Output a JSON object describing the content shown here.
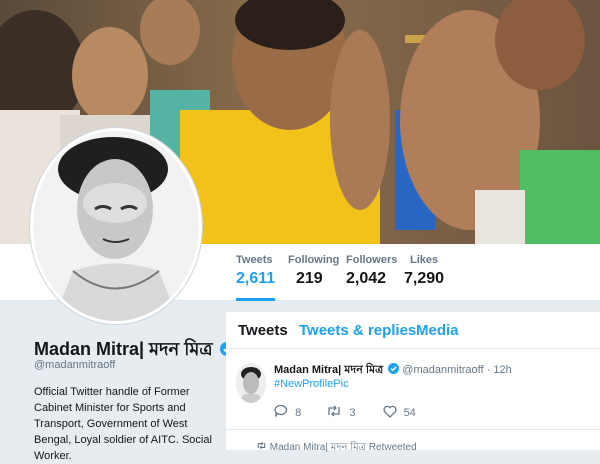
{
  "profile": {
    "name": "Madan Mitra| মদন মিত্র",
    "handle": "@madanmitraoff",
    "bio": "Official Twitter handle of Former Cabinet Minister for Sports and Transport, Government of West Bengal, Loyal soldier of AITC. Social Worker."
  },
  "stats": [
    {
      "label": "Tweets",
      "value": "2,611"
    },
    {
      "label": "Following",
      "value": "219"
    },
    {
      "label": "Followers",
      "value": "2,042"
    },
    {
      "label": "Likes",
      "value": "7,290"
    }
  ],
  "tabs": [
    {
      "label": "Tweets"
    },
    {
      "label": "Tweets & replies"
    },
    {
      "label": "Media"
    }
  ],
  "tweet": {
    "name": "Madan Mitra| মদন মিত্র",
    "handle": "@madanmitraoff",
    "separator": "·",
    "time": "12h",
    "text": "#NewProfilePic",
    "replies": "8",
    "retweets": "3",
    "likes": "54"
  },
  "retweeted_line": "Madan Mitra| মদন মিত্র Retweeted",
  "colors": {
    "accent": "#1da1f2",
    "verified": "#1da1f2"
  },
  "icons": [
    "reply-icon",
    "retweet-icon",
    "heart-icon",
    "verified-badge-icon"
  ]
}
